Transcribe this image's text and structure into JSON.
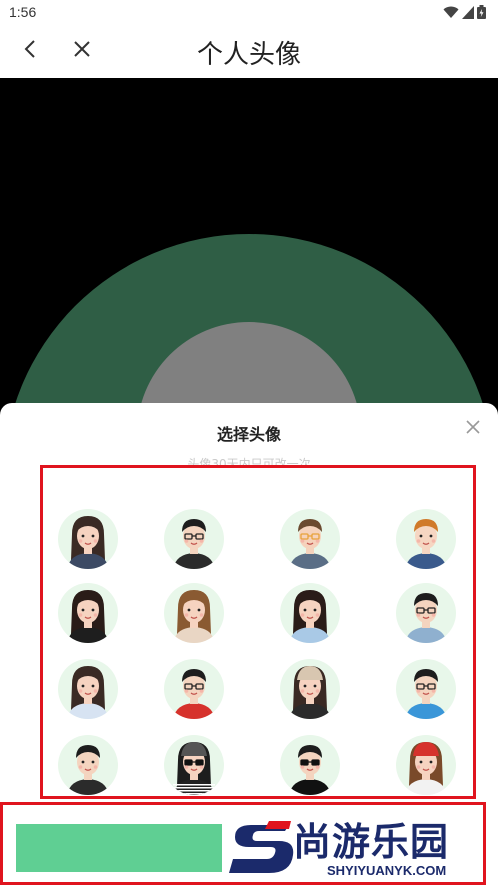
{
  "status_bar": {
    "time": "1:56",
    "icons": [
      "wifi-icon",
      "signal-icon",
      "battery-icon"
    ]
  },
  "header": {
    "title": "个人头像",
    "back_icon": "chevron-left-icon",
    "close_icon": "close-icon"
  },
  "preview": {
    "outer_ring_color": "#2f5e45",
    "inner_circle_color": "#808080"
  },
  "sheet": {
    "title": "选择头像",
    "subtitle": "头像30天内只可改一次",
    "close_icon": "close-icon"
  },
  "avatars": [
    {
      "id": "female-long-dark-hair"
    },
    {
      "id": "male-glasses-black-shirt"
    },
    {
      "id": "male-orange-glasses"
    },
    {
      "id": "male-orange-hair"
    },
    {
      "id": "female-long-hair-black"
    },
    {
      "id": "female-brown-hair"
    },
    {
      "id": "female-long-hair-blue"
    },
    {
      "id": "male-glasses-suit"
    },
    {
      "id": "female-short-hair"
    },
    {
      "id": "male-glasses-red-hoodie"
    },
    {
      "id": "female-beige-cap"
    },
    {
      "id": "male-glasses-blue-shirt"
    },
    {
      "id": "male-short-hair-dark"
    },
    {
      "id": "female-cap-sunglasses-striped"
    },
    {
      "id": "male-sunglasses-black"
    },
    {
      "id": "female-red-beret"
    }
  ],
  "watermark": {
    "brand": "尚游乐园",
    "url": "SHYIYUANYK.COM"
  },
  "colors": {
    "accent_green": "#5fcf93",
    "highlight_red": "#e0141e",
    "brand_navy": "#1b2a6b",
    "brand_red": "#e0141e"
  }
}
